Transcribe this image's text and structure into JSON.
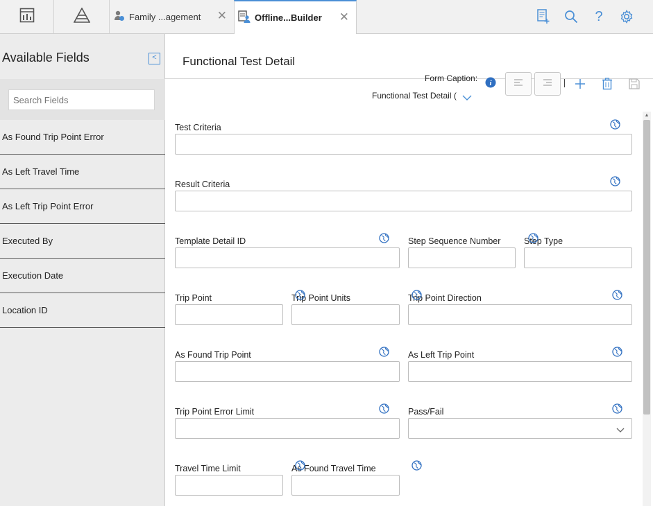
{
  "topbar": {
    "tabs": [
      {
        "label": "Family ...agement",
        "icon": "family-management-icon",
        "close": "✕"
      },
      {
        "label": "Offline...Builder",
        "icon": "offline-builder-icon",
        "close": "✕"
      }
    ],
    "left_icons": [
      "dashboard-icon",
      "pyramid-icon"
    ],
    "right_icons": [
      "add-document-icon",
      "search-icon",
      "help-icon",
      "settings-icon"
    ],
    "help_glyph": "?",
    "accent": "#4a8fd6"
  },
  "sidebar": {
    "title": "Available Fields",
    "collapse_glyph": "<",
    "search_placeholder": "Search Fields",
    "fields": [
      "As Found Trip Point Error",
      "As Left Travel Time",
      "As Left Trip Point Error",
      "Executed By",
      "Execution Date",
      "Location ID"
    ]
  },
  "main": {
    "title": "Functional Test Detail",
    "form_caption_label": "Form Caption:",
    "form_caption_value": "Functional Test Detail (",
    "fields": {
      "test_criteria": "Test Criteria",
      "result_criteria": "Result Criteria",
      "template_detail_id": "Template Detail ID",
      "step_sequence_number": "Step Sequence Number",
      "step_type": "Step Type",
      "trip_point": "Trip Point",
      "trip_point_units": "Trip Point Units",
      "trip_point_direction": "Trip Point Direction",
      "as_found_trip_point": "As Found Trip Point",
      "as_left_trip_point": "As Left Trip Point",
      "trip_point_error_limit": "Trip Point Error Limit",
      "pass_fail": "Pass/Fail",
      "travel_time_limit": "Travel Time Limit",
      "as_found_travel_time": "As Found Travel Time"
    }
  }
}
